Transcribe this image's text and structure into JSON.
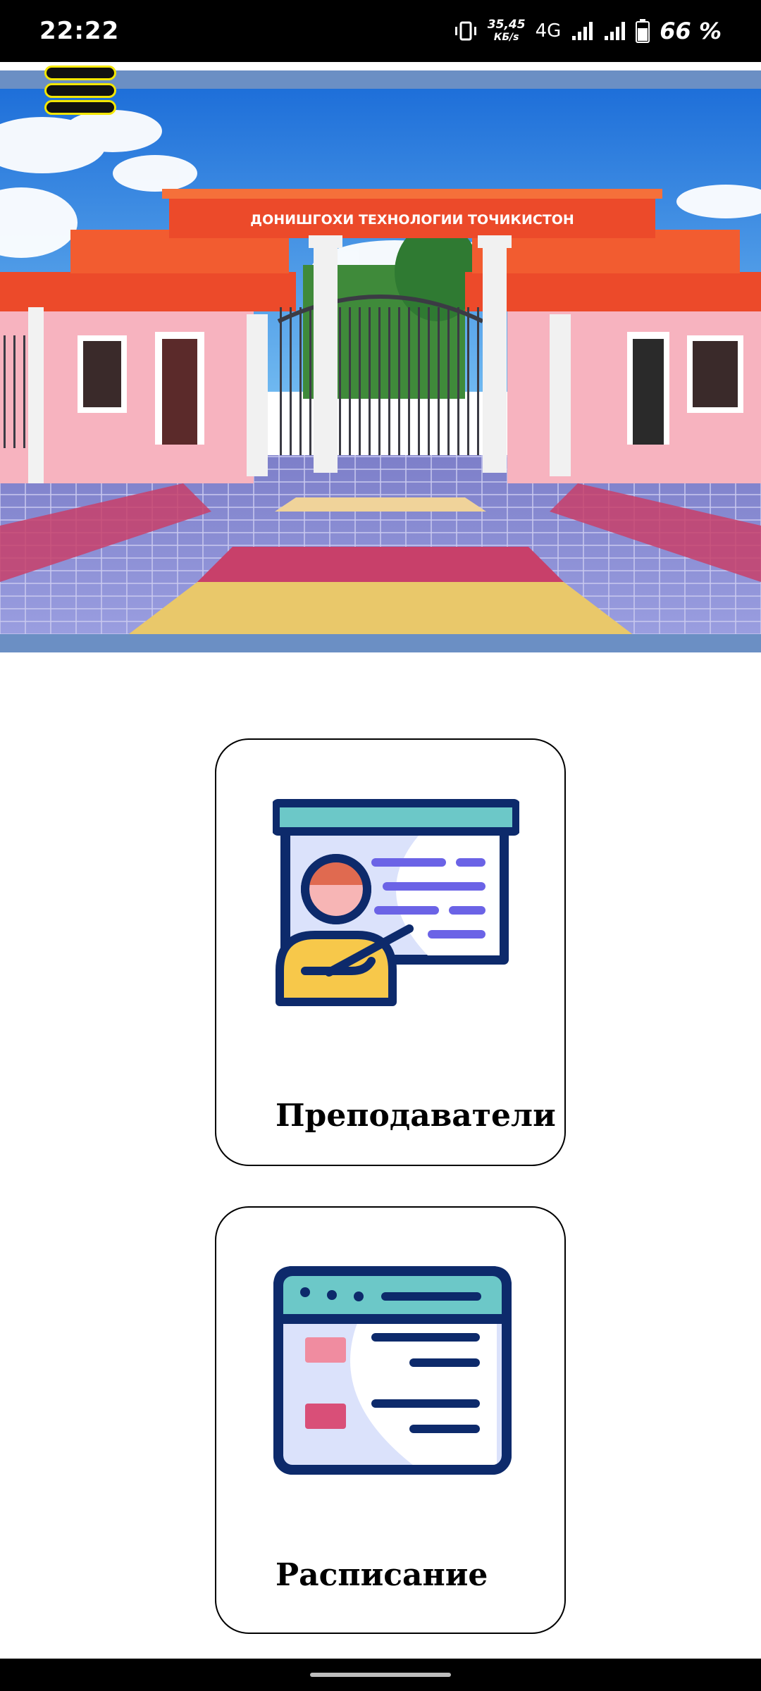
{
  "status_bar": {
    "time": "22:22",
    "net_speed_value": "35,45",
    "net_speed_unit": "КБ/s",
    "network_type": "4G",
    "battery_percent": "66 %"
  },
  "header": {
    "menu_icon": "hamburger-menu-icon"
  },
  "hero": {
    "gate_sign": "ДОНИШГОХИ ТЕХНОЛОГИИ ТОЧИКИСТОН"
  },
  "cards": [
    {
      "label": "Преподаватели",
      "icon": "teacher-presentation-icon"
    },
    {
      "label": "Расписание",
      "icon": "schedule-window-icon"
    }
  ],
  "colors": {
    "status_bar_bg": "#000000",
    "accent_blue": "#6b8fc4",
    "icon_navy": "#0d2a6b",
    "icon_teal": "#6cc8c8",
    "icon_lavender": "#dbe2fb",
    "icon_purple": "#6b63e6",
    "icon_yellow": "#f7c84a",
    "icon_pink": "#f08ca0"
  }
}
